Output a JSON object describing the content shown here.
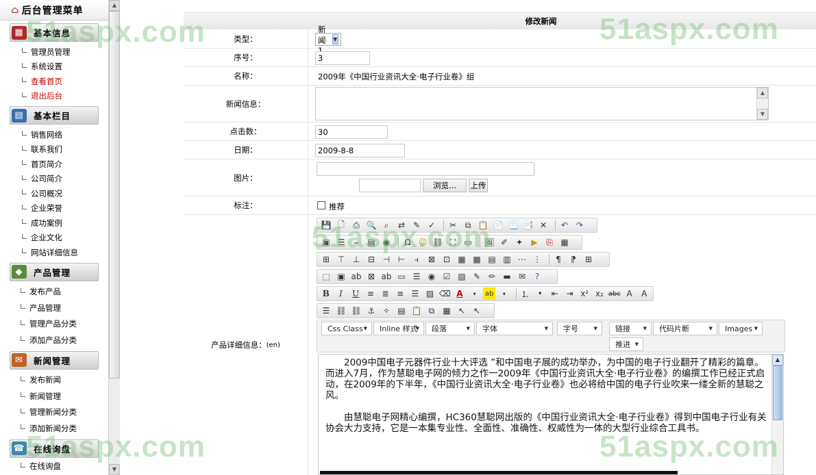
{
  "sidebar": {
    "title": "后台管理菜单",
    "groups": [
      {
        "header": "基本信息",
        "icon": "info-icon",
        "items": [
          {
            "label": "管理员管理",
            "red": false
          },
          {
            "label": "系统设置",
            "red": false
          },
          {
            "label": "查看首页",
            "red": true
          },
          {
            "label": "退出后台",
            "red": true
          }
        ]
      },
      {
        "header": "基本栏目",
        "icon": "columns-icon",
        "items": [
          {
            "label": "销售网络"
          },
          {
            "label": "联系我们"
          },
          {
            "label": "首页简介"
          },
          {
            "label": "公司简介"
          },
          {
            "label": "公司概况"
          },
          {
            "label": "企业荣誉"
          },
          {
            "label": "成功案例"
          },
          {
            "label": "企业文化"
          },
          {
            "label": "网站详细信息"
          }
        ]
      },
      {
        "header": "产品管理",
        "icon": "product-icon",
        "items": [
          {
            "label": "发布产品"
          },
          {
            "label": "产品管理"
          },
          {
            "label": "管理产品分类"
          },
          {
            "label": "添加产品分类"
          }
        ]
      },
      {
        "header": "新闻管理",
        "icon": "news-icon",
        "items": [
          {
            "label": "发布新闻"
          },
          {
            "label": "新闻管理"
          },
          {
            "label": "管理新闻分类"
          },
          {
            "label": "添加新闻分类"
          }
        ]
      },
      {
        "header": "在线询盘",
        "icon": "inquiry-icon",
        "items": [
          {
            "label": "在线询盘"
          }
        ]
      }
    ]
  },
  "form": {
    "title": "修改新闻",
    "type_label": "类型：",
    "type_value": "新闻1",
    "order_label": "序号：",
    "order_value": "3",
    "name_label": "名称：",
    "name_value": "2009年《中国行业资讯大全·电子行业卷》组",
    "newsinfo_label": "新闻信息：",
    "clicks_label": "点击数：",
    "clicks_value": "30",
    "date_label": "日期：",
    "date_value": "2009-8-8",
    "image_label": "图片：",
    "browse_label": "浏览...",
    "upload_label": "上传",
    "tag_label": "标注：",
    "recommend_label": "推荐",
    "detail_label": "产品详细信息：",
    "detail_lang": "(en)"
  },
  "editor": {
    "combos": {
      "css_class": "Css Class",
      "inline_style": "Inline 样式",
      "paragraph": "段落",
      "font": "字体",
      "font_size": "字号",
      "link": "链接",
      "code_snippet": "代码片断",
      "images": "Images",
      "push": "推进"
    },
    "content": [
      "2009中国电子元器件行业十大评选 ”和中国电子展的成功举办，为中国的电子行业翻开了精彩的篇章。而进入7月，作为慧聪电子网的倾力之作一2009年《中国行业资讯大全·电子行业卷》的编撰工作已经正式启动，在2009年的下半年，《中国行业资讯大全·电子行业卷》也必将给中国的电子行业吹来一缕全新的慧聪之风。",
      "由慧聪电子网精心编撰，HC360慧聪网出版的《中国行业资讯大全·电子行业卷》得到中国电子行业有关协会大力支持，它是一本集专业性、全面性、准确性、权威性为一体的大型行业综合工具书。"
    ]
  },
  "watermark": "51aspx.com"
}
